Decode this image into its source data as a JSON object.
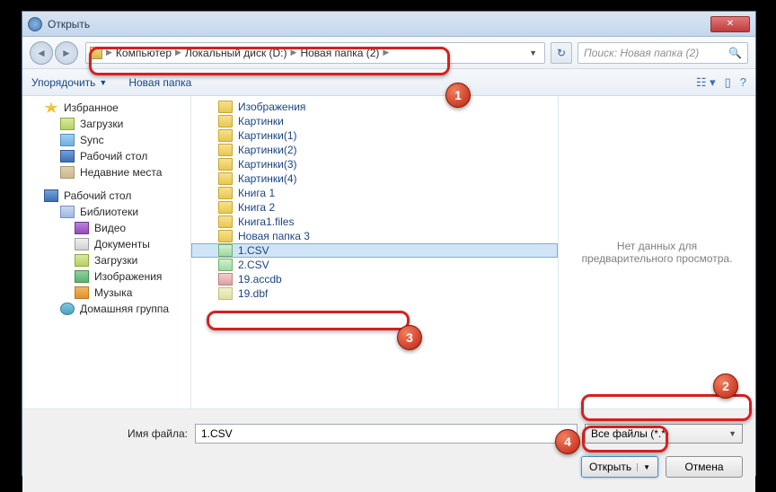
{
  "window": {
    "title": "Открыть"
  },
  "nav": {
    "breadcrumb": [
      "Компьютер",
      "Локальный диск (D:)",
      "Новая папка (2)"
    ],
    "search_placeholder": "Поиск: Новая папка (2)"
  },
  "toolbar": {
    "organize": "Упорядочить",
    "newfolder": "Новая папка"
  },
  "sidebar": {
    "favorites": {
      "label": "Избранное",
      "items": [
        "Загрузки",
        "Sync",
        "Рабочий стол",
        "Недавние места"
      ]
    },
    "desktop": {
      "label": "Рабочий стол",
      "libraries": {
        "label": "Библиотеки",
        "items": [
          "Видео",
          "Документы",
          "Загрузки",
          "Изображения",
          "Музыка"
        ]
      },
      "homegroup": "Домашняя группа"
    }
  },
  "files": {
    "folders": [
      "Изображения",
      "Картинки",
      "Картинки(1)",
      "Картинки(2)",
      "Картинки(3)",
      "Картинки(4)",
      "Книга 1",
      "Книга 2",
      "Книга1.files",
      "Новая папка 3"
    ],
    "selected": "1.CSV",
    "items": [
      "2.CSV",
      "19.accdb",
      "19.dbf"
    ]
  },
  "preview": {
    "text": "Нет данных для предварительного просмотра."
  },
  "bottom": {
    "filename_label": "Имя файла:",
    "filename_value": "1.CSV",
    "filter": "Все файлы (*.*)",
    "open": "Открыть",
    "cancel": "Отмена"
  },
  "badges": {
    "b1": "1",
    "b2": "2",
    "b3": "3",
    "b4": "4"
  }
}
